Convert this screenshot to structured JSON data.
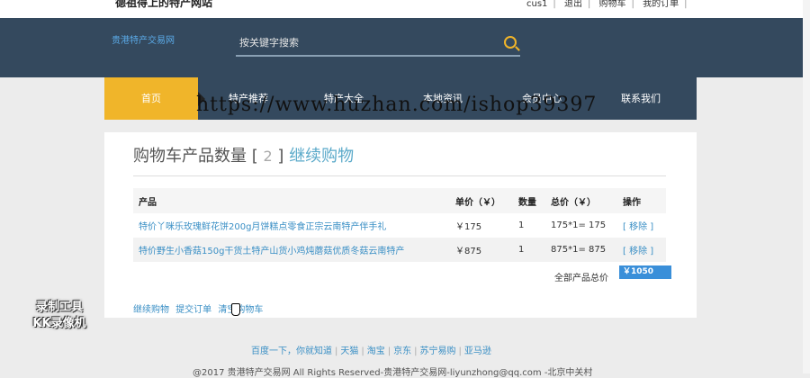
{
  "top": {
    "site_name": "德祖得上的特产网站",
    "links": [
      "cus1",
      "退出",
      "购物车",
      "我的订单"
    ]
  },
  "header": {
    "logo": "贵港特产交易网",
    "search_placeholder": "按关键字搜索"
  },
  "nav": {
    "items": [
      "首页",
      "特产推荐",
      "特产大全",
      "本地资讯",
      "会员中心",
      "联系我们"
    ],
    "active": "首页"
  },
  "watermark": "https://www.huzhan.com/ishop39397",
  "cart": {
    "title": "购物车产品数量",
    "bracket_open": "[",
    "count": "2",
    "bracket_close": "]",
    "continue_link": "继续购物",
    "columns": [
      "产品",
      "单价（￥）",
      "数量",
      "总价（￥）",
      "操作"
    ],
    "rows": [
      {
        "name": "特价丫咪乐玫瑰鲜花饼200g月饼糕点零食正宗云南特产伴手礼",
        "price": "￥175",
        "qty": "1",
        "total": "175*1= 175",
        "action": "[ 移除 ]"
      },
      {
        "name": "特价野生小香菇150g干货土特产山货小鸡炖蘑菇优质冬菇云南特产",
        "price": "￥875",
        "qty": "1",
        "total": "875*1= 875",
        "action": "[ 移除 ]"
      }
    ],
    "total_label": "全部产品总价",
    "total_value": "￥1050",
    "actions": [
      "继续购物",
      "提交订单",
      "清空购物车"
    ]
  },
  "badge": {
    "line1": "录制工具",
    "line2": "KK录像机"
  },
  "footer": {
    "links": [
      "百度一下，你就知道",
      "天猫",
      "淘宝",
      "京东",
      "苏宁易购",
      "亚马逊"
    ],
    "copyright": "@2017 贵港特产交易网 All Rights Reserved-贵港特产交易网-liyunzhong@qq.com -北京中关村"
  }
}
